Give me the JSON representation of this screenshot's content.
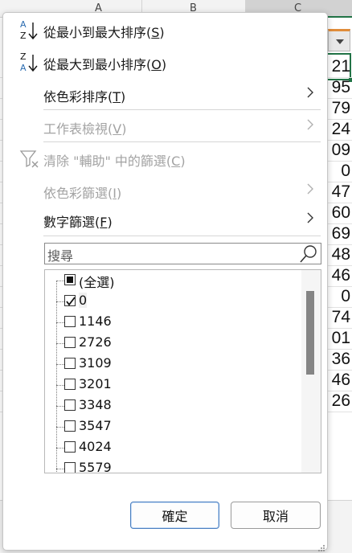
{
  "sheet": {
    "columns": [
      "A",
      "B",
      "C"
    ],
    "visible_cell_values": [
      "21",
      "95",
      "79",
      "24",
      "09",
      "0",
      "47",
      "60",
      "69",
      "48",
      "46",
      "0",
      "74",
      "01",
      "36",
      "46",
      "26"
    ]
  },
  "menu": {
    "sort_asc": {
      "label": "從最小到最大排序(",
      "key": "S",
      "end": ")"
    },
    "sort_desc": {
      "label": "從最大到最小排序(",
      "key": "O",
      "end": ")"
    },
    "sort_by_color": {
      "label": "依色彩排序(",
      "key": "T",
      "end": ")"
    },
    "sheet_view": {
      "label": "工作表檢視(",
      "key": "V",
      "end": ")"
    },
    "clear_filter": {
      "label": "清除 \"輔助\" 中的篩選(",
      "key": "C",
      "end": ")"
    },
    "filter_by_color": {
      "label": "依色彩篩選(",
      "key": "I",
      "end": ")"
    },
    "number_filters": {
      "label": "數字篩選(",
      "key": "F",
      "end": ")"
    }
  },
  "search": {
    "placeholder": "搜尋"
  },
  "filter_list": {
    "select_all": {
      "label": "(全選)",
      "state": "partial"
    },
    "items": [
      {
        "label": "0",
        "checked": true
      },
      {
        "label": "1146",
        "checked": false
      },
      {
        "label": "2726",
        "checked": false
      },
      {
        "label": "3109",
        "checked": false
      },
      {
        "label": "3201",
        "checked": false
      },
      {
        "label": "3348",
        "checked": false
      },
      {
        "label": "3547",
        "checked": false
      },
      {
        "label": "4024",
        "checked": false
      },
      {
        "label": "5579",
        "checked": false
      }
    ]
  },
  "buttons": {
    "ok": "確定",
    "cancel": "取消"
  },
  "colors": {
    "accent": "#217346",
    "filter_tab": "#e08c3a",
    "disabled": "#a3a3a3"
  }
}
